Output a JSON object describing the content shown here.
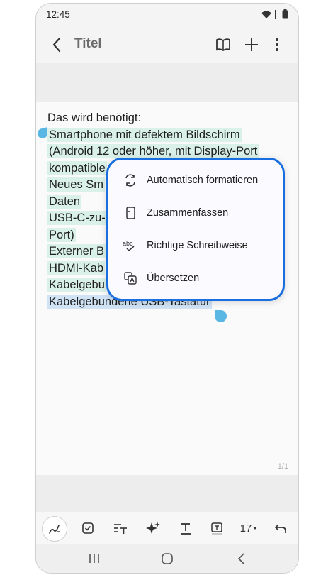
{
  "status": {
    "time": "12:45"
  },
  "appbar": {
    "title": "Titel"
  },
  "note": {
    "lines": [
      "Das wird benötigt:",
      "Smartphone mit defektem Bildschirm",
      "(Android 12 oder höher, mit Display-Port",
      "kompatible",
      "Neues Sm",
      "Daten",
      "USB-C-zu-H",
      "Port)",
      "Externer B",
      "HDMI-Kab",
      "Kabelgebu",
      "Kabelgebundene USB-Tastatur"
    ],
    "page_indicator": "1/1"
  },
  "popup": {
    "items": [
      {
        "label": "Automatisch formatieren",
        "icon": "auto-format-icon"
      },
      {
        "label": "Zusammenfassen",
        "icon": "summarize-icon"
      },
      {
        "label": "Richtige Schreibweise",
        "icon": "spell-check-icon"
      },
      {
        "label": "Übersetzen",
        "icon": "translate-icon"
      }
    ]
  },
  "format_toolbar": {
    "font_size": "17"
  },
  "colors": {
    "accent": "#1a6fe0",
    "highlight": "#d9f1e8",
    "handle": "#5ab7e4"
  }
}
